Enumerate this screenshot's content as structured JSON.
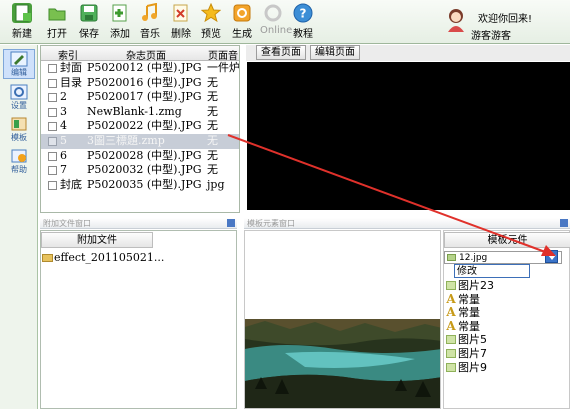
{
  "toolbar": {
    "items": [
      {
        "label": "新建",
        "icon": "new-icon",
        "color": "#4a9e3c",
        "disabled": false
      },
      {
        "label": "打开",
        "icon": "open-icon",
        "color": "#5aa83f",
        "disabled": false
      },
      {
        "label": "保存",
        "icon": "save-icon",
        "color": "#3f9a5a",
        "disabled": false
      },
      {
        "label": "添加",
        "icon": "add-icon",
        "color": "#49a64a",
        "disabled": false
      },
      {
        "label": "音乐",
        "icon": "music-icon",
        "color": "#f0a62a",
        "disabled": false
      },
      {
        "label": "删除",
        "icon": "delete-icon",
        "color": "#d9c36a",
        "disabled": false
      },
      {
        "label": "预览",
        "icon": "preview-star-icon",
        "color": "#f2b51c",
        "disabled": false
      },
      {
        "label": "生成",
        "icon": "generate-icon",
        "color": "#f09a1a",
        "disabled": false
      },
      {
        "label": "Online",
        "icon": "online-icon",
        "color": "#cfcfcf",
        "disabled": true
      },
      {
        "label": "教程",
        "icon": "help-icon",
        "color": "#3c8ed6",
        "disabled": false
      }
    ]
  },
  "user": {
    "welcome": "欢迎你回来!",
    "name": "游客游客"
  },
  "sidenav": {
    "items": [
      {
        "label": "编辑",
        "icon": "edit-icon",
        "active": true
      },
      {
        "label": "设置",
        "icon": "settings-icon",
        "active": false
      },
      {
        "label": "模板",
        "icon": "template-icon",
        "active": false
      },
      {
        "label": "帮助",
        "icon": "help-book-icon",
        "active": false
      }
    ]
  },
  "pagelist": {
    "headers": {
      "index": "索引",
      "page": "杂志页面",
      "music": "页面音"
    },
    "rows": [
      {
        "idx": "封面",
        "name": "P5020012 (中型).JPG",
        "flag": "一件炉",
        "selected": false
      },
      {
        "idx": "目录",
        "name": "P5020016 (中型).JPG",
        "flag": "无",
        "selected": false
      },
      {
        "idx": "2",
        "name": "P5020017 (中型).JPG",
        "flag": "无",
        "selected": false
      },
      {
        "idx": "3",
        "name": "NewBlank-1.zmg",
        "flag": "无",
        "selected": false
      },
      {
        "idx": "4",
        "name": "P5020022 (中型).JPG",
        "flag": "无",
        "selected": false
      },
      {
        "idx": "5",
        "name": "3圖三標題.zmp",
        "flag": "无",
        "selected": true
      },
      {
        "idx": "6",
        "name": "P5020028 (中型).JPG",
        "flag": "无",
        "selected": false
      },
      {
        "idx": "7",
        "name": "P5020032 (中型).JPG",
        "flag": "无",
        "selected": false
      },
      {
        "idx": "封底",
        "name": "P5020035 (中型).JPG",
        "flag": "jpg",
        "selected": false
      }
    ]
  },
  "preview": {
    "tab_view": "查看页面",
    "tab_edit": "编辑页面"
  },
  "attach": {
    "title": "附加文件窗口",
    "header": "附加文件",
    "file": "effect_201105021..."
  },
  "template": {
    "title": "模板元素窗口"
  },
  "elements": {
    "header": "模板元件",
    "dropdown_value": "12.jpg",
    "modify_label": "修改",
    "items": [
      {
        "label": "图片23",
        "type": "image"
      },
      {
        "label": "常量",
        "type": "text"
      },
      {
        "label": "常量",
        "type": "text"
      },
      {
        "label": "常量",
        "type": "text"
      },
      {
        "label": "图片5",
        "type": "image"
      },
      {
        "label": "图片7",
        "type": "image"
      },
      {
        "label": "图片9",
        "type": "image"
      }
    ]
  },
  "colors": {
    "annotation_arrow": "#e0312b",
    "accent_blue": "#3b74c9",
    "selected_row": "#c7cdd7"
  }
}
